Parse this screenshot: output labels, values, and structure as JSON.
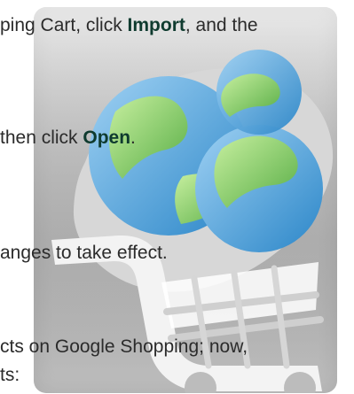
{
  "content": {
    "lines": [
      {
        "before": "ping Cart, click ",
        "bold": "Import",
        "after": ", and the"
      },
      {
        "before": " then click ",
        "bold": "Open",
        "after": "."
      },
      {
        "text": "anges to take effect."
      },
      {
        "text": "cts on Google Shopping; now,"
      },
      {
        "text": "ts:"
      }
    ]
  },
  "overlay": {
    "icon_name": "globe-cart-icon",
    "colors": {
      "blue": "#4ea3df",
      "green": "#8dcf6e",
      "cart_gray": "#eeeeee"
    }
  }
}
